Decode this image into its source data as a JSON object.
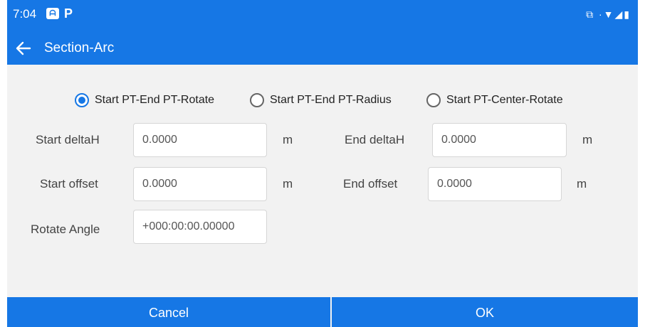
{
  "status_bar": {
    "time": "7:04",
    "notification_glyph": "ᗩ",
    "app_glyph": "P",
    "icons": "⧉ ·▼◢▮"
  },
  "app_bar": {
    "title": "Section-Arc"
  },
  "mode_options": [
    {
      "label": "Start PT-End PT-Rotate",
      "checked": true
    },
    {
      "label": "Start PT-End PT-Radius",
      "checked": false
    },
    {
      "label": "Start PT-Center-Rotate",
      "checked": false
    }
  ],
  "fields": {
    "start_delta_h": {
      "label": "Start deltaH",
      "value": "0.0000",
      "unit": "m"
    },
    "end_delta_h": {
      "label": "End deltaH",
      "value": "0.0000",
      "unit": "m"
    },
    "start_offset": {
      "label": "Start offset",
      "value": "0.0000",
      "unit": "m"
    },
    "end_offset": {
      "label": "End offset",
      "value": "0.0000",
      "unit": "m"
    },
    "rotate_angle": {
      "label": "Rotate Angle",
      "value": "+000:00:00.00000"
    }
  },
  "buttons": {
    "cancel": "Cancel",
    "ok": "OK"
  },
  "colors": {
    "accent": "#1677e5",
    "background": "#f2f2f2"
  }
}
